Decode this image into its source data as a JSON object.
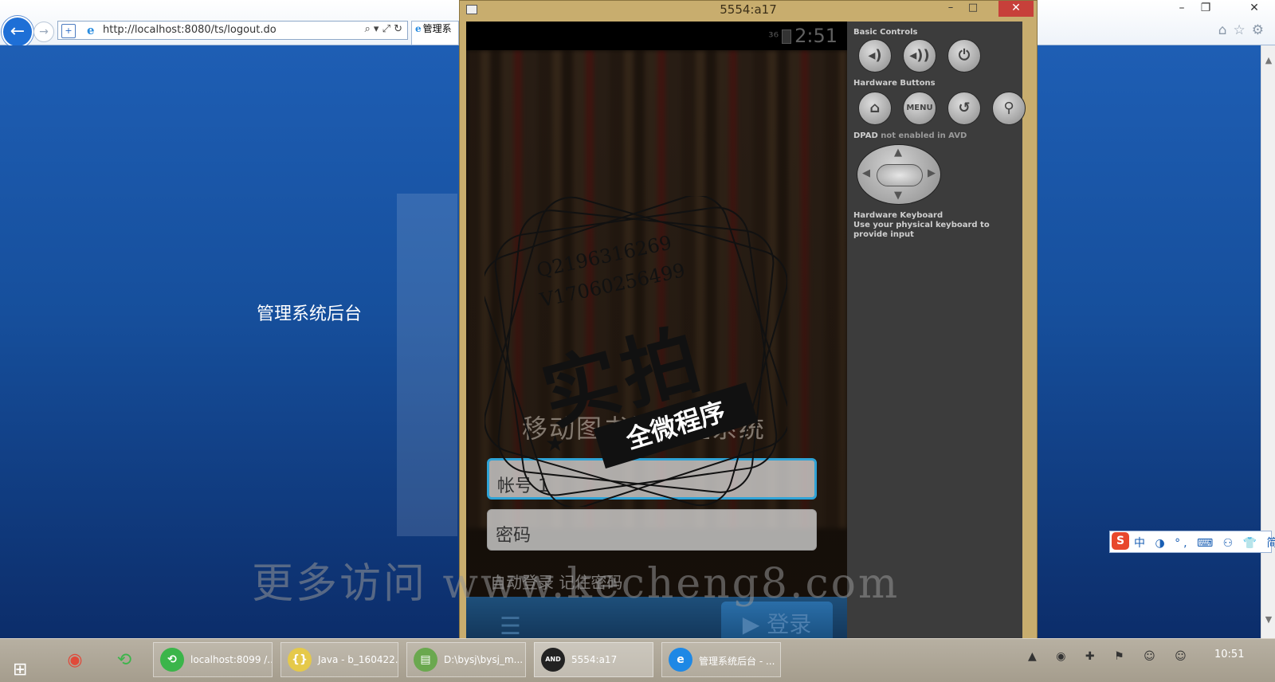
{
  "browser": {
    "url": "http://localhost:8080/ts/logout.do",
    "tab_title": "管理系",
    "page_title": "管理系统后台",
    "tools": "⌕ ▾ ⤢ ↻"
  },
  "emulator": {
    "window_title": "5554:a17",
    "status_time": "2:51",
    "signal": "³⁶",
    "app_title": "移动图书馆管理系统",
    "username_field": "帐号 1",
    "password_placeholder": "密码",
    "remember_text": "自动登录  记住密码",
    "login_label": "登录",
    "controls": {
      "basic_label": "Basic Controls",
      "hardware_label": "Hardware Buttons",
      "menu_label": "MENU",
      "dpad_label": "DPAD",
      "dpad_note": "not enabled in AVD",
      "keyboard_label": "Hardware Keyboard",
      "keyboard_note": "Use your physical keyboard to provide input"
    }
  },
  "watermark": {
    "qq": "Q2196316269",
    "wechat": "V17060256499",
    "big": "实拍",
    "ribbon": "全微程序",
    "site": "更多访问 www.kecheng8.com"
  },
  "ime": {
    "s": "S",
    "rest": "中 ◑ °, ⌨ ⚇ 👕 简 🔧"
  },
  "taskbar": {
    "tasks": [
      {
        "label": "localhost:8099 /...",
        "icon_color": "#3bb54a"
      },
      {
        "label": "Java - b_160422...",
        "icon_color": "#e5c94a"
      },
      {
        "label": "D:\\bysj\\bysj_m...",
        "icon_color": "#6aa84f"
      },
      {
        "label": "5554:a17",
        "icon_color": "#222222"
      },
      {
        "label": "管理系统后台 - ...",
        "icon_color": "#1e88e5"
      }
    ],
    "clock": "10:51"
  },
  "colors": {
    "page_top": "#1e5eb4",
    "page_bottom": "#0c2d6a",
    "emulator_frame": "#c8ad6e",
    "focus_border": "#2fa3d6"
  }
}
